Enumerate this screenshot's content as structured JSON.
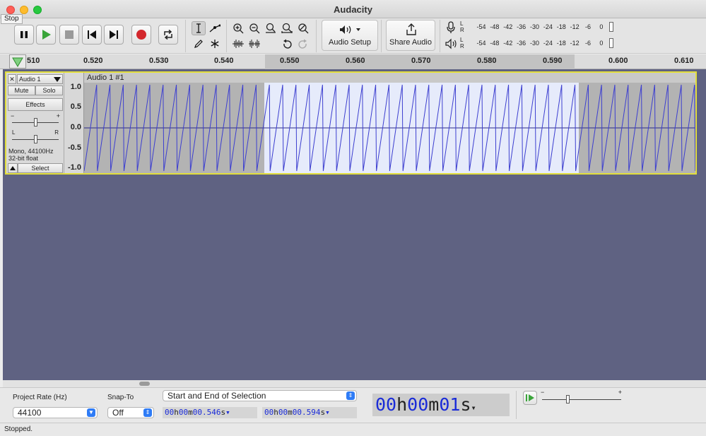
{
  "window": {
    "title": "Audacity"
  },
  "tooltip": "Stop",
  "toolbar": {
    "audio_setup_label": "Audio Setup",
    "share_audio_label": "Share Audio",
    "meter_lr": [
      "L",
      "R"
    ],
    "meter_scale": [
      "-54",
      "-48",
      "-42",
      "-36",
      "-30",
      "-24",
      "-18",
      "-12",
      "-6",
      "0"
    ]
  },
  "ruler": {
    "ticks": [
      "510",
      "0.520",
      "0.530",
      "0.540",
      "0.550",
      "0.560",
      "0.570",
      "0.580",
      "0.590",
      "0.600",
      "0.610"
    ]
  },
  "track": {
    "name": "Audio 1",
    "clip_name": "Audio 1 #1",
    "mute_label": "Mute",
    "solo_label": "Solo",
    "effects_label": "Effects",
    "gain_minus": "−",
    "gain_plus": "+",
    "pan_left": "L",
    "pan_right": "R",
    "info_line1": "Mono, 44100Hz",
    "info_line2": "32-bit float",
    "select_label": "Select",
    "vruler": [
      "1.0",
      "0.5",
      "0.0",
      "-0.5",
      "-1.0"
    ]
  },
  "bottom": {
    "project_rate_label": "Project Rate (Hz)",
    "project_rate_value": "44100",
    "snap_to_label": "Snap-To",
    "snap_to_value": "Off",
    "selection_mode": "Start and End of Selection",
    "sel_start": {
      "h": "00",
      "m": "00",
      "s": "00.546"
    },
    "sel_end": {
      "h": "00",
      "m": "00",
      "s": "00.594"
    },
    "time_display": {
      "h": "00",
      "m": "00",
      "s": "01"
    },
    "unit_h": "h",
    "unit_m": "m",
    "unit_s": "s",
    "play_speed_minus": "−",
    "play_speed_plus": "+"
  },
  "status": {
    "text": "Stopped."
  },
  "colors": {
    "waveform": "#3d3fd0",
    "selection": "#e6ebfb",
    "track_border": "#e2de3c",
    "background": "#5f6282",
    "record": "#d3282d",
    "play": "#3aa53a",
    "accent": "#2f7cf6"
  }
}
